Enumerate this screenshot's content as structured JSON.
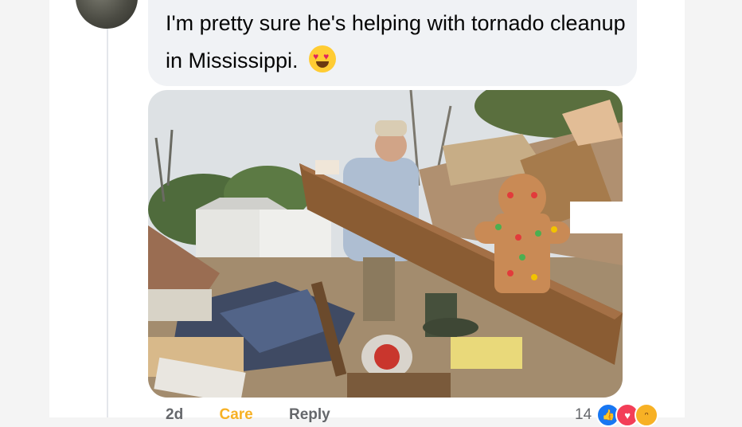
{
  "comment": {
    "text": "I'm pretty sure he's helping with tornado cleanup in Mississippi.",
    "emoji": "heart-eyes-emoji"
  },
  "actions": {
    "time": "2d",
    "care_label": "Care",
    "reply_label": "Reply"
  },
  "reactions": {
    "count": "14",
    "icons": [
      "like-icon",
      "love-icon",
      "haha-icon"
    ]
  },
  "colors": {
    "bubble": "#f0f2f5",
    "care": "#f7b125",
    "meta": "#65676b",
    "like": "#1877f2",
    "love": "#f33e58"
  }
}
